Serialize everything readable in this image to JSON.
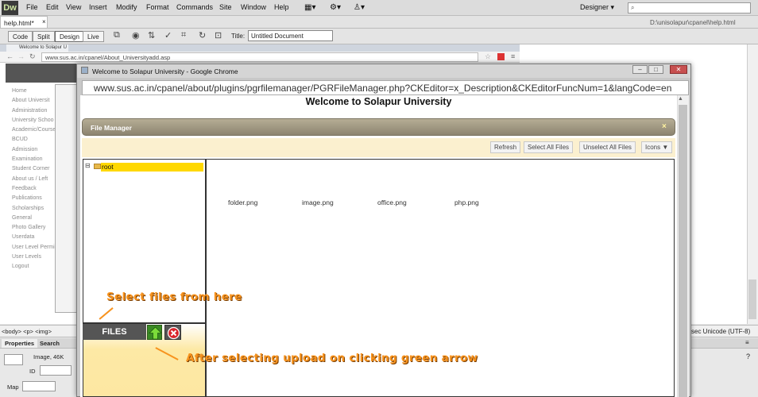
{
  "dreamweaver": {
    "logo": "Dw",
    "menus": [
      "File",
      "Edit",
      "View",
      "Insert",
      "Modify",
      "Format",
      "Commands",
      "Site",
      "Window",
      "Help"
    ],
    "workspace": "Designer",
    "doc_tab": "help.html*",
    "doc_path": "D:\\unisolapur\\cpanel\\help.html",
    "view_buttons": [
      "Code",
      "Split",
      "Design",
      "Live"
    ],
    "title_label": "Title:",
    "title_value": "Untitled Document",
    "tag_selector": "<body> <p> <img>",
    "encoding_info": "sec  Unicode (UTF-8)",
    "properties_tab": "Properties",
    "search_tab": "Search",
    "image_info": "Image, 46K",
    "id_label": "ID",
    "map_label": "Map",
    "help_icon": "?"
  },
  "background_browser": {
    "tab": "Welcome to Solapur U",
    "url": "www.sus.ac.in/cpanel/About_Universityadd.asp",
    "nav_items": [
      "Home",
      "About Universit",
      "Administration",
      "University Schoo",
      "Academic/Course",
      "BCUD",
      "Admission",
      "Examination",
      "Student Corner",
      "About us / Left",
      "Feedback",
      "Publications",
      "Scholarships",
      "General",
      "Photo Gallery",
      "Userdata",
      "User Level Permi",
      "User Levels",
      "Logout"
    ]
  },
  "popup": {
    "window_title": "Welcome to Solapur University - Google Chrome",
    "url": "www.sus.ac.in/cpanel/about/plugins/pgrfilemanager/PGRFileManager.php?CKEditor=x_Description&CKEditorFuncNum=1&langCode=en",
    "page_heading": "Welcome to Solapur University"
  },
  "file_manager": {
    "title": "File Manager",
    "close_glyph": "×",
    "toolbar": {
      "refresh": "Refresh",
      "select_all": "Select All Files",
      "unselect_all": "Unselect All Files",
      "view_mode": "Icons ▼"
    },
    "tree_expand": "⊟",
    "tree_root": "root",
    "files": [
      "folder.png",
      "image.png",
      "office.png",
      "php.png"
    ],
    "upload_label": "FILES"
  },
  "annotations": {
    "select_hint": "Select files from here",
    "upload_hint": "After selecting upload on clicking green arrow"
  },
  "colors": {
    "annotation": "#f7931e",
    "selected_root": "#ffd800",
    "upload_arrow": "#3a8a24",
    "cancel_button": "#d9242b"
  }
}
